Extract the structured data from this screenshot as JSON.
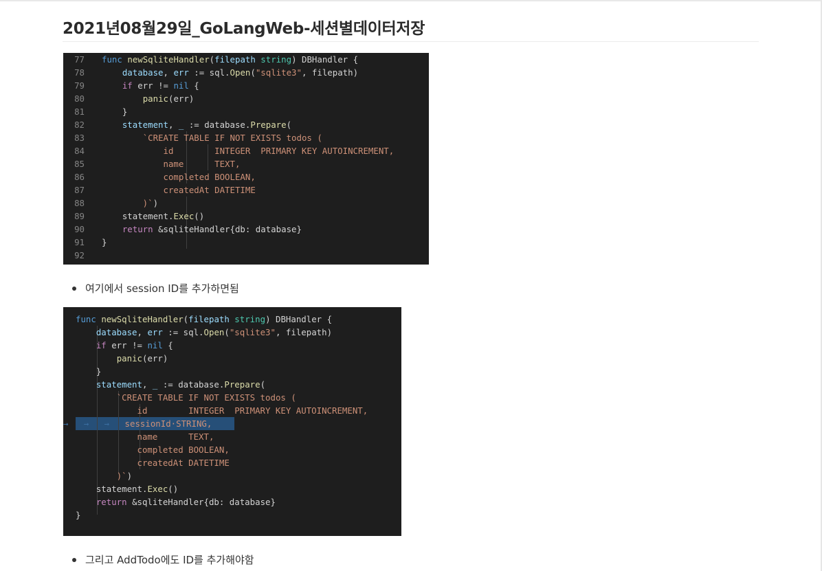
{
  "page": {
    "title": "2021년08월29일_GoLangWeb-세션별데이터저장"
  },
  "code_block_1": {
    "line_numbers": [
      "77",
      "78",
      "79",
      "80",
      "81",
      "82",
      "83",
      "84",
      "85",
      "86",
      "87",
      "88",
      "89",
      "90",
      "91",
      "92"
    ],
    "lines": [
      "func newSqliteHandler(filepath string) DBHandler {",
      "    database, err := sql.Open(\"sqlite3\", filepath)",
      "    if err != nil {",
      "        panic(err)",
      "    }",
      "    statement, _ := database.Prepare(",
      "        `CREATE TABLE IF NOT EXISTS todos (",
      "            id        INTEGER  PRIMARY KEY AUTOINCREMENT,",
      "            name      TEXT,",
      "            completed BOOLEAN,",
      "            createdAt DATETIME",
      "        )`)",
      "    statement.Exec()",
      "    return &sqliteHandler{db: database}",
      "}",
      ""
    ]
  },
  "bullet_1": {
    "text": "여기에서 session ID를 추가하면됨"
  },
  "code_block_2": {
    "lines": [
      "func newSqliteHandler(filepath string) DBHandler {",
      "    database, err := sql.Open(\"sqlite3\", filepath)",
      "    if err != nil {",
      "        panic(err)",
      "    }",
      "    statement, _ := database.Prepare(",
      "        `CREATE TABLE IF NOT EXISTS todos (",
      "            id        INTEGER  PRIMARY KEY AUTOINCREMENT,",
      "            sessionId STRING,",
      "            name      TEXT,",
      "            completed BOOLEAN,",
      "            createdAt DATETIME",
      "        )`)",
      "    statement.Exec()",
      "    return &sqliteHandler{db: database}",
      "}"
    ],
    "selected_line": "            sessionId STRING,"
  },
  "bullet_2": {
    "text": "그리고 AddTodo에도 ID를 추가해야함"
  },
  "colors": {
    "code_background": "#1e1e1e",
    "keyword": "#569cd6",
    "function": "#dcdcaa",
    "type": "#4ec9b0",
    "string": "#ce9178",
    "variable": "#9cdcfe",
    "control": "#c586c0",
    "selection": "#264f78",
    "line_number": "#858585"
  }
}
